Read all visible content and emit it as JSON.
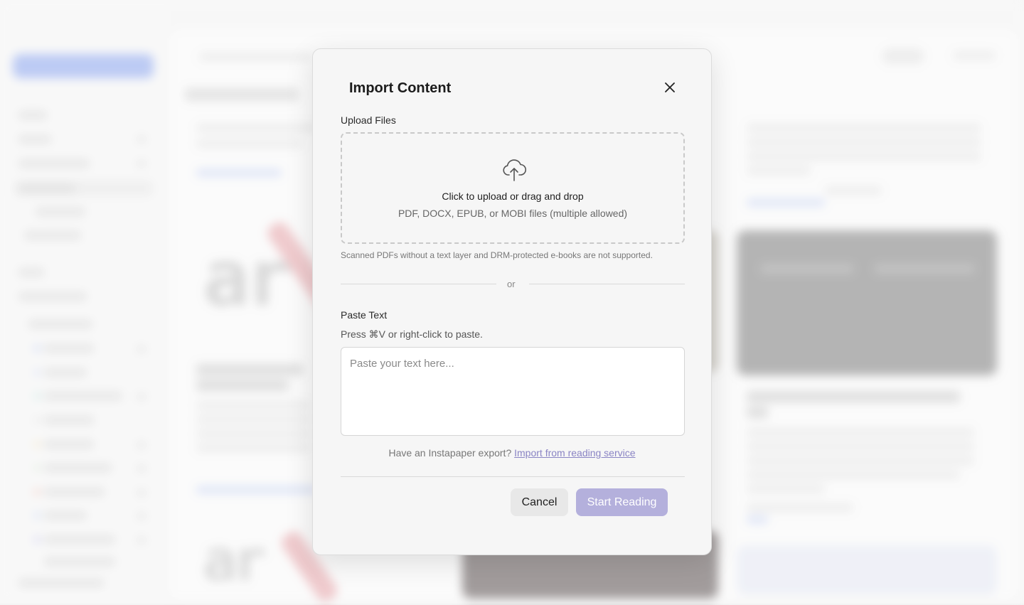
{
  "modal": {
    "title": "Import Content",
    "close_icon": "close-icon",
    "upload": {
      "label": "Upload Files",
      "icon": "upload-cloud-icon",
      "main_text": "Click to upload or drag and drop",
      "sub_text": "PDF, DOCX, EPUB, or MOBI files (multiple allowed)",
      "hint": "Scanned PDFs without a text layer and DRM-protected e-books are not supported."
    },
    "divider_text": "or",
    "paste": {
      "label": "Paste Text",
      "help": "Press ⌘V or right-click to paste.",
      "placeholder": "Paste your text here...",
      "value": ""
    },
    "import": {
      "prompt": "Have an Instapaper export?",
      "link": "Import from reading service"
    },
    "buttons": {
      "cancel": "Cancel",
      "start": "Start Reading"
    }
  },
  "colors": {
    "accent_disabled": "#b4b0dc",
    "link": "#8a84c4",
    "sidebar_primary": "#8aa4ee"
  }
}
